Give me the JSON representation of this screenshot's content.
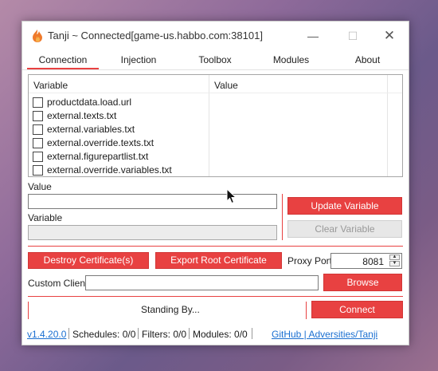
{
  "window": {
    "title": "Tanji ~ Connected[game-us.habbo.com:38101]",
    "min_glyph": "—",
    "max_glyph": "☐",
    "close_glyph": "✕"
  },
  "tabs": [
    {
      "label": "Connection",
      "active": true
    },
    {
      "label": "Injection"
    },
    {
      "label": "Toolbox"
    },
    {
      "label": "Modules"
    },
    {
      "label": "About"
    }
  ],
  "variables_table": {
    "headers": [
      "Variable",
      "Value"
    ],
    "rows": [
      {
        "variable": "productdata.load.url",
        "value": ""
      },
      {
        "variable": "external.texts.txt",
        "value": ""
      },
      {
        "variable": "external.variables.txt",
        "value": ""
      },
      {
        "variable": "external.override.texts.txt",
        "value": ""
      },
      {
        "variable": "external.figurepartlist.txt",
        "value": ""
      },
      {
        "variable": "external.override.variables.txt",
        "value": ""
      }
    ]
  },
  "editor": {
    "value_label": "Value",
    "value_text": "",
    "variable_label": "Variable",
    "variable_text": "",
    "update_button": "Update Variable",
    "clear_button": "Clear Variable"
  },
  "certificates": {
    "destroy_button": "Destroy Certificate(s)",
    "export_button": "Export Root Certificate"
  },
  "proxy": {
    "label": "Proxy Port:",
    "port": "8081",
    "up_glyph": "▲",
    "down_glyph": "▼"
  },
  "custom_client": {
    "label": "Custom Client:",
    "value": "",
    "browse_button": "Browse"
  },
  "status": {
    "text": "Standing By...",
    "connect_button": "Connect"
  },
  "statusbar": {
    "version": "v1.4.20.0",
    "schedules": "Schedules: 0/0",
    "filters": "Filters: 0/0",
    "modules": "Modules: 0/0",
    "github": "GitHub | Adversities/Tanji"
  },
  "colors": {
    "accent": "#e84141",
    "link": "#1a6fd1"
  }
}
